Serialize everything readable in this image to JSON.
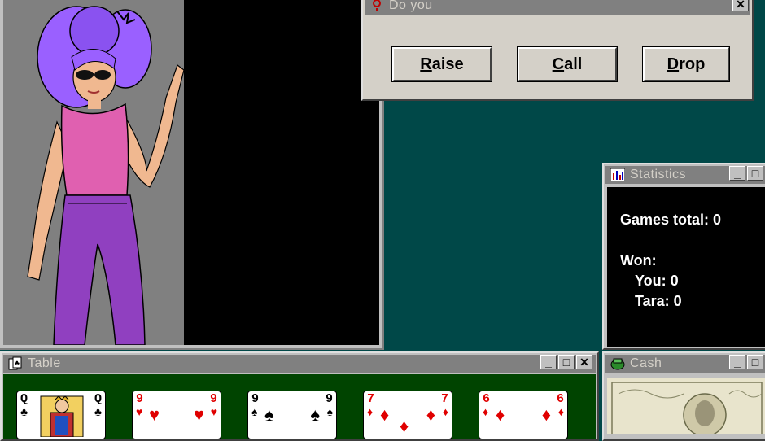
{
  "colors": {
    "desktop": "#004848",
    "portrait_bg": "#808080",
    "table_felt": "#004400",
    "stats_bg": "#000000",
    "accent_hair": "#9a60ff",
    "card_red": "#e00000"
  },
  "dialog": {
    "title": "Do you",
    "buttons": {
      "raise_prefix": "R",
      "raise_rest": "aise",
      "call_prefix": "C",
      "call_rest": "all",
      "drop_prefix": "D",
      "drop_rest": "rop"
    },
    "close_glyph": "✕"
  },
  "statistics": {
    "title": "Statistics",
    "games_total": "Games total: 0",
    "won_label": "Won:",
    "you": "You: 0",
    "tara": "Tara: 0"
  },
  "table": {
    "title": "Table",
    "cards": [
      {
        "rank": "Q",
        "suit": "♣",
        "color": "black"
      },
      {
        "rank": "9",
        "suit": "♥",
        "color": "red"
      },
      {
        "rank": "9",
        "suit": "♠",
        "color": "black"
      },
      {
        "rank": "7",
        "suit": "♦",
        "color": "red"
      },
      {
        "rank": "6",
        "suit": "♦",
        "color": "red"
      }
    ]
  },
  "cash": {
    "title": "Cash"
  },
  "window_buttons": {
    "minimize": "_",
    "maximize": "□",
    "close": "✕"
  }
}
